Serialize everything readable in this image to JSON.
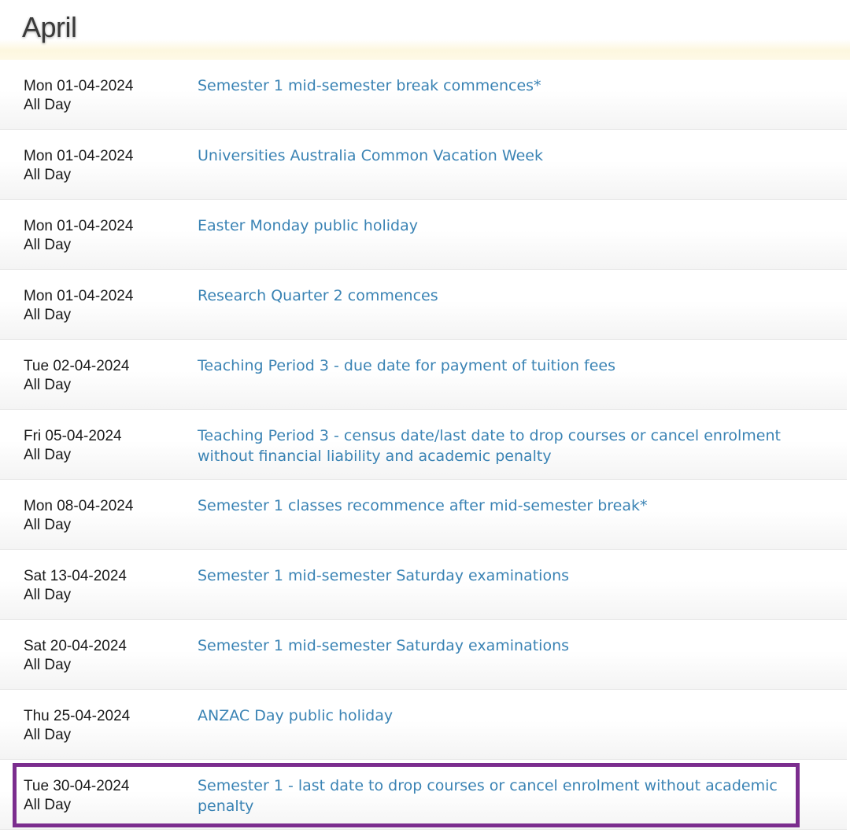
{
  "month": "April",
  "events": [
    {
      "date": "Mon 01-04-2024",
      "time": "All Day",
      "title": "Semester 1 mid-semester break commences*"
    },
    {
      "date": "Mon 01-04-2024",
      "time": "All Day",
      "title": "Universities Australia Common Vacation Week"
    },
    {
      "date": "Mon 01-04-2024",
      "time": "All Day",
      "title": "Easter Monday public holiday"
    },
    {
      "date": "Mon 01-04-2024",
      "time": "All Day",
      "title": "Research Quarter 2 commences"
    },
    {
      "date": "Tue 02-04-2024",
      "time": "All Day",
      "title": "Teaching Period 3 - due date for payment of tuition fees"
    },
    {
      "date": "Fri 05-04-2024",
      "time": "All Day",
      "title": "Teaching Period 3 - census date/last date to drop courses or cancel enrolment without financial liability and academic penalty"
    },
    {
      "date": "Mon 08-04-2024",
      "time": "All Day",
      "title": "Semester 1 classes recommence after mid-semester break*"
    },
    {
      "date": "Sat 13-04-2024",
      "time": "All Day",
      "title": "Semester 1 mid-semester Saturday examinations"
    },
    {
      "date": "Sat 20-04-2024",
      "time": "All Day",
      "title": "Semester 1 mid-semester Saturday examinations"
    },
    {
      "date": "Thu 25-04-2024",
      "time": "All Day",
      "title": "ANZAC Day public holiday"
    },
    {
      "date": "Tue 30-04-2024",
      "time": "All Day",
      "title": "Semester 1 - last date to drop courses or cancel enrolment without academic penalty"
    }
  ],
  "colors": {
    "link": "#3a83b4",
    "highlight": "#7b2d8e",
    "header_band": "#fef9e6"
  }
}
